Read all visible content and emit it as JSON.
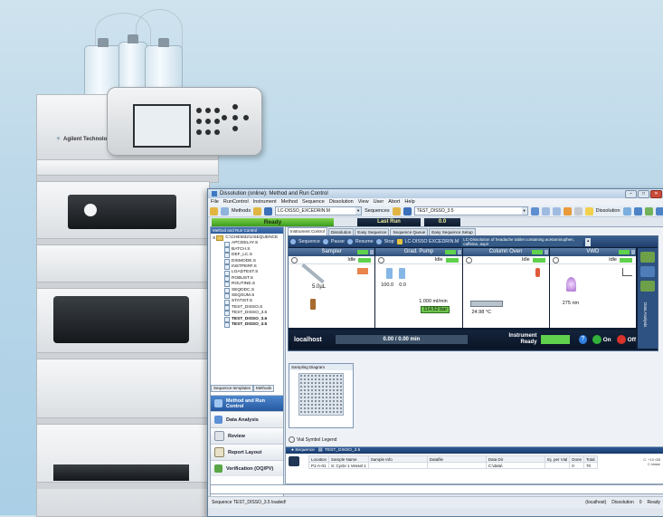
{
  "window": {
    "title": "Dissolution (online): Method and Run Control"
  },
  "menubar": [
    "File",
    "RunControl",
    "Instrument",
    "Method",
    "Sequence",
    "Dissolution",
    "View",
    "User",
    "Abort",
    "Help"
  ],
  "toolbar": {
    "methods_label": "Methods",
    "method_value": "LC-DISSO_EXCEDRIN.M",
    "sequences_label": "Sequences",
    "sequence_value": "TEST_DISSO_3.5",
    "dissolution_label": "Dissolution"
  },
  "status": {
    "ready": "Ready",
    "last_run": "Last Run",
    "value": "0.0"
  },
  "left_pane": {
    "header": "Method and Run Control",
    "root": "C:\\CHEM32\\1\\SEQUENCE",
    "files": [
      "APCDELAY.S",
      "BATCH.S",
      "DEF_LC.S",
      "DISMODE.S",
      "INSTPERF.S",
      "LOADTEST.S",
      "ROBUST.S",
      "ROUTINE.S",
      "SEQDDC.S",
      "SEQSUM.S",
      "STATIST.S",
      "TEST_DISSO.S",
      "TEST_DISSO_3.5",
      "TEST_DISSO_3.6",
      "TEST_DISSO_3.5"
    ],
    "tabs": [
      "Sequence templates",
      "Methods"
    ],
    "nav": [
      "Method and Run Control",
      "Data Analysis",
      "Review",
      "Report Layout",
      "Verification (OQ/PV)"
    ]
  },
  "main_tabs": [
    "Instrument Control",
    "Dissolution",
    "Easy Sequence",
    "Sequence Queue",
    "Easy Sequence Setup"
  ],
  "ic_toolbar": {
    "sequence": "Sequence",
    "pause": "Pause",
    "resume": "Resume",
    "stop": "Stop",
    "method": "LC-DISSO EXCEDRIN.M",
    "description": "LC-Dissolution of headache tablet containing acetaminophen, caffeine, aspir"
  },
  "modules": [
    {
      "name": "Sampler",
      "state": "Idle",
      "values": [
        "5.0µL"
      ]
    },
    {
      "name": "Grad. Pump",
      "state": "Idle",
      "values": [
        "100.0",
        "0.0",
        "1.000 ml/min",
        "114.52",
        "bar"
      ]
    },
    {
      "name": "Column Oven",
      "state": "Idle",
      "values": [
        "24.98 °C"
      ]
    },
    {
      "name": "VWD",
      "state": "Idle",
      "values": [
        "275 nm"
      ]
    }
  ],
  "ic_bottom": {
    "host": "localhost",
    "runtime": "0.00 / 0.00 min",
    "instrument": "Instrument",
    "ready": "Ready",
    "help": "?",
    "on": "On",
    "off": "Off"
  },
  "data_analysis_side": "Data Analysis",
  "sampling": {
    "title": "Sampling Diagram",
    "legend": "Vial Symbol Legend"
  },
  "sequence_panel": {
    "label": "Sequence",
    "name": "TEST_DISSO_3.5",
    "headers": [
      "Location",
      "Sample Name",
      "Sample Info",
      "Datafile",
      "Data Dir",
      "Inj. per Vial",
      "Done",
      "Total"
    ],
    "row": [
      "P1-A-01",
      "S: Cycle 1 Vessel 1",
      "",
      "",
      "C:\\data\\",
      "",
      "0",
      "70"
    ],
    "right_info": [
      "C: +10 GB",
      "C:\\data\\"
    ]
  },
  "statusbar": {
    "message": "Sequence TEST_DISSO_3.5 loaded!",
    "items": [
      "(localhost)",
      "Dissolution",
      "0",
      "Ready"
    ]
  },
  "hardware": {
    "brand": "Agilent Technologies"
  },
  "colors": {
    "ready_green": "#3b9b1d",
    "nav_active": "#2559a0",
    "panel_dark": "#0f1d33"
  }
}
